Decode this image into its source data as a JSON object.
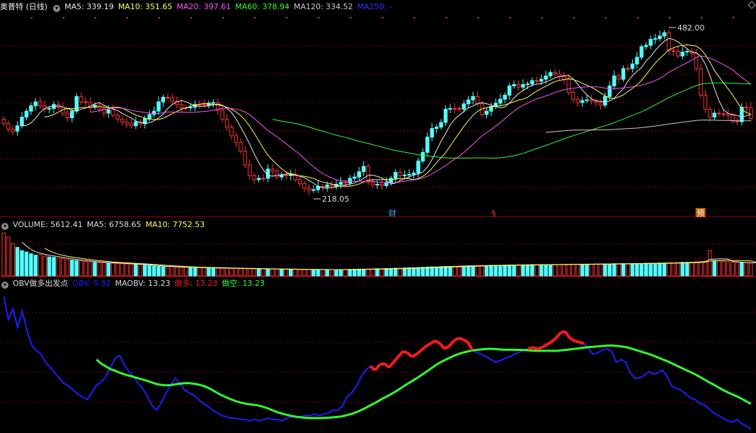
{
  "colors": {
    "up": "#ff3232",
    "down": "#54ffff",
    "ma5": "#e8e8e8",
    "ma10": "#ffff55",
    "ma20": "#ff55ff",
    "ma60": "#33ff33",
    "ma120": "#cccccc",
    "ma250": "#3333ff",
    "grid": "#8b0000",
    "obv": "#1e1eff",
    "maobv": "#33ff33",
    "long": "#ff1a1a"
  },
  "price_panel": {
    "title": "奥普特 (日线)",
    "ma_labels": [
      {
        "text": "MA5: 339.19",
        "color": "#e8e8e8"
      },
      {
        "text": "MA10: 351.65",
        "color": "#ffff55"
      },
      {
        "text": "MA20: 397.61",
        "color": "#ff55ff"
      },
      {
        "text": "MA60: 378.94",
        "color": "#33ff33"
      },
      {
        "text": "MA120: 334.52",
        "color": "#cccccc"
      },
      {
        "text": "MA250: -",
        "color": "#3333ff"
      }
    ],
    "high_label": "482.00",
    "low_label": "218.05",
    "markers": [
      {
        "text": "财",
        "color": "#33aaff"
      },
      {
        "text": "§",
        "color": "#ff3333"
      },
      {
        "text": "预",
        "color": "#ffcc33"
      }
    ]
  },
  "volume_panel": {
    "labels": [
      {
        "text": "VOLUME: 5612.41",
        "color": "#dddddd"
      },
      {
        "text": "MA5: 6758.65",
        "color": "#dddddd"
      },
      {
        "text": "MA10: 7752.53",
        "color": "#ffff55"
      }
    ]
  },
  "obv_panel": {
    "labels": [
      {
        "text": "OBV做多出发点",
        "color": "#dddddd"
      },
      {
        "text": "OBV: 9.82",
        "color": "#1e1eff"
      },
      {
        "text": "MAOBV: 13.23",
        "color": "#dddddd"
      },
      {
        "text": "做多: 13.23",
        "color": "#ff1a1a"
      },
      {
        "text": "做空: 13.23",
        "color": "#33ff33"
      }
    ]
  },
  "chart_data": {
    "type": "candlestick",
    "y_range_price": [
      200,
      500
    ],
    "price": {
      "high": 482.0,
      "low": 218.05,
      "close": [
        340,
        333,
        325,
        322,
        330,
        343,
        352,
        360,
        366,
        360,
        355,
        356,
        362,
        358,
        349,
        342,
        352,
        374,
        366,
        365,
        358,
        361,
        355,
        349,
        354,
        346,
        340,
        336,
        333,
        330,
        336,
        333,
        341,
        347,
        352,
        366,
        373,
        372,
        367,
        362,
        357,
        357,
        358,
        362,
        362,
        361,
        364,
        365,
        353,
        340,
        328,
        315,
        305,
        292,
        271,
        255,
        249,
        251,
        251,
        265,
        262,
        253,
        256,
        255,
        257,
        249,
        243,
        236,
        233,
        234,
        239,
        238,
        241,
        239,
        242,
        245,
        244,
        251,
        253,
        261,
        269,
        245,
        241,
        242,
        240,
        245,
        251,
        260,
        255,
        256,
        257,
        259,
        277,
        290,
        313,
        326,
        328,
        335,
        355,
        356,
        356,
        355,
        363,
        369,
        374,
        363,
        347,
        352,
        359,
        364,
        370,
        376,
        390,
        392,
        388,
        392,
        393,
        398,
        397,
        400,
        405,
        410,
        408,
        404,
        400,
        380,
        370,
        365,
        368,
        369,
        367,
        365,
        361,
        374,
        390,
        405,
        400,
        416,
        416,
        423,
        433,
        449,
        451,
        460,
        461,
        465,
        470,
        443,
        442,
        435,
        441,
        442,
        439,
        416,
        376,
        355,
        343,
        349,
        348,
        348,
        346,
        337,
        336,
        358,
        357
      ],
      "open": [
        333,
        325,
        322,
        330,
        343,
        352,
        360,
        366,
        360,
        355,
        356,
        362,
        358,
        349,
        342,
        352,
        374,
        366,
        365,
        358,
        361,
        355,
        349,
        354,
        346,
        340,
        336,
        333,
        330,
        336,
        333,
        341,
        347,
        352,
        366,
        373,
        372,
        367,
        362,
        357,
        357,
        358,
        362,
        362,
        361,
        364,
        365,
        353,
        340,
        328,
        315,
        305,
        292,
        271,
        255,
        249,
        251,
        251,
        265,
        262,
        253,
        256,
        255,
        257,
        249,
        243,
        236,
        233,
        234,
        239,
        238,
        241,
        239,
        242,
        245,
        244,
        251,
        253,
        261,
        269,
        245,
        241,
        242,
        240,
        245,
        251,
        260,
        255,
        256,
        257,
        259,
        277,
        290,
        313,
        326,
        328,
        335,
        355,
        356,
        356,
        355,
        363,
        369,
        374,
        363,
        347,
        352,
        359,
        364,
        370,
        376,
        390,
        392,
        388,
        392,
        393,
        398,
        397,
        400,
        405,
        410,
        408,
        404,
        400,
        380,
        370,
        365,
        368,
        369,
        367,
        365,
        361,
        374,
        390,
        405,
        400,
        416,
        416,
        423,
        433,
        449,
        451,
        460,
        461,
        465,
        470,
        443,
        442,
        435,
        441,
        442,
        439,
        416,
        376,
        355,
        343,
        349,
        348,
        348,
        346,
        337,
        336,
        358,
        357,
        341
      ]
    },
    "ma5_note": "moving averages computed from closes",
    "volume": [
      9500,
      8600,
      7200,
      6300,
      5600,
      5300,
      4900,
      4600,
      4700,
      4400,
      4200,
      4100,
      3900,
      3800,
      3600,
      3500,
      3400,
      3300,
      3200,
      3100,
      3000,
      2950,
      2900,
      2850,
      2800,
      2750,
      2700,
      2650,
      2600,
      2550,
      2500,
      2400,
      2300,
      2200,
      2100,
      2050,
      2000,
      2000,
      1950,
      1900,
      1900,
      1900,
      1850,
      1800,
      1800,
      1800,
      1750,
      1700,
      1700,
      1700,
      1650,
      1650,
      1600,
      1600,
      1600,
      1600,
      1550,
      1550,
      1500,
      1500,
      1500,
      1500,
      1450,
      1450,
      1450,
      1400,
      1400,
      1400,
      1400,
      1400,
      1400,
      1400,
      1400,
      1400,
      1400,
      1450,
      1450,
      1450,
      1500,
      1500,
      1550,
      1550,
      1600,
      1600,
      1650,
      1650,
      1700,
      1700,
      1750,
      1800,
      1800,
      1850,
      1900,
      1950,
      2000,
      2000,
      2050,
      2100,
      2100,
      2150,
      2200,
      2200,
      2250,
      2250,
      2300,
      2300,
      2300,
      2350,
      2350,
      2350,
      2400,
      2400,
      2400,
      2450,
      2450,
      2450,
      2500,
      2500,
      2500,
      2500,
      2500,
      2550,
      2550,
      2550,
      2550,
      2600,
      2600,
      2600,
      2600,
      2600,
      2650,
      2650,
      2650,
      2650,
      2700,
      2700,
      2700,
      2700,
      2750,
      2750,
      2750,
      2800,
      2800,
      2800,
      2850,
      2850,
      2900,
      2900,
      2950,
      3000,
      3000,
      3050,
      3100,
      3200,
      3300,
      5612,
      3400,
      3300,
      3200,
      3100,
      3000,
      3000,
      2950,
      2900,
      2850,
      2800,
      2800,
      2750
    ],
    "volume_max": 10000,
    "obv": [
      13.5,
      11.8,
      12.6,
      11.2,
      12.4,
      11.0,
      9.9,
      9.5,
      9.2,
      8.6,
      8.2,
      7.8,
      7.4,
      7.0,
      6.8,
      6.5,
      6.2,
      6.0,
      5.8,
      6.3,
      6.9,
      7.1,
      7.5,
      8.2,
      8.9,
      9.1,
      8.4,
      7.9,
      7.5,
      7.0,
      6.6,
      6.0,
      5.3,
      5.0,
      5.6,
      6.3,
      6.9,
      7.4,
      7.0,
      6.5,
      6.3,
      6.1,
      5.8,
      5.5,
      5.3,
      5.0,
      4.8,
      4.6,
      4.5,
      4.4,
      4.4,
      4.3,
      4.3,
      4.2,
      4.3,
      4.2,
      4.3,
      4.4,
      4.3,
      4.3,
      4.2,
      4.4,
      4.5,
      4.5,
      4.5,
      4.6,
      4.6,
      4.7,
      4.6,
      4.7,
      4.8,
      5.0,
      5.0,
      5.3,
      6.0,
      6.3,
      6.8,
      7.5,
      8.0,
      8.3,
      8.0,
      8.4,
      8.5,
      8.2,
      8.6,
      9.0,
      9.4,
      9.3,
      9.0,
      9.2,
      9.5,
      9.8,
      10.0,
      10.2,
      10.0,
      9.6,
      9.8,
      10.2,
      10.4,
      10.3,
      10.1,
      9.5,
      9.3,
      9.2,
      9.0,
      8.8,
      8.6,
      8.7,
      8.9,
      9.0,
      9.2,
      9.3,
      9.5,
      9.6,
      9.7,
      9.6,
      9.7,
      9.9,
      10.1,
      10.4,
      10.8,
      10.9,
      10.4,
      10.2,
      10.1,
      10.0,
      9.6,
      9.2,
      9.3,
      9.5,
      9.6,
      9.4,
      8.6,
      8.8,
      8.6,
      7.8,
      7.4,
      7.4,
      7.6,
      7.9,
      7.7,
      7.8,
      8.0,
      7.5,
      6.8,
      6.6,
      6.5,
      6.2,
      5.9,
      5.8,
      5.5,
      5.4,
      5.1,
      4.8,
      4.6,
      4.4,
      4.2,
      4.1,
      4.3,
      4.0,
      3.8,
      3.6
    ],
    "obv_range": [
      3.5,
      14
    ]
  }
}
